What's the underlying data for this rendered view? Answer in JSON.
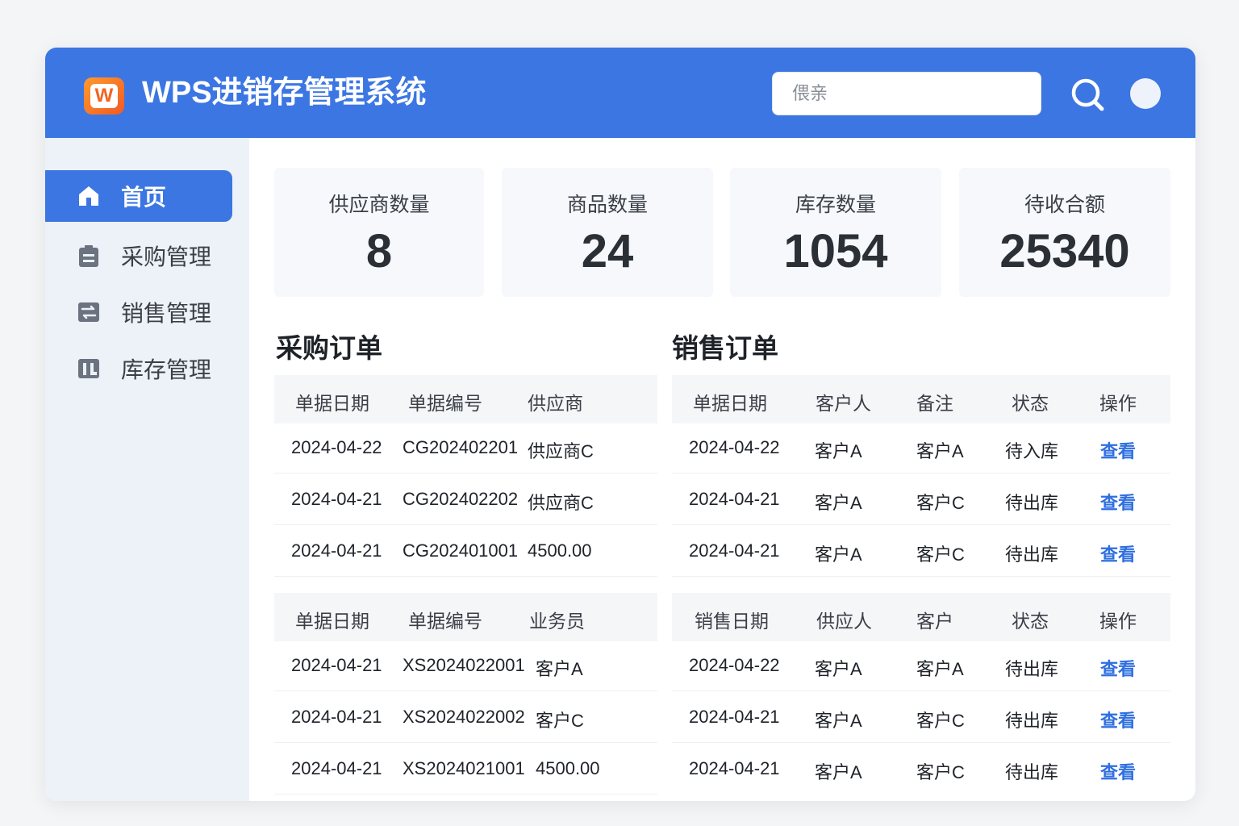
{
  "header": {
    "logo_letter": "W",
    "title": "WPS进销存管理系统",
    "search_placeholder": "偎亲"
  },
  "sidebar": {
    "items": [
      {
        "label": "首页",
        "icon": "home-icon",
        "active": true
      },
      {
        "label": "采购管理",
        "icon": "clipboard-icon",
        "active": false
      },
      {
        "label": "销售管理",
        "icon": "transfer-icon",
        "active": false
      },
      {
        "label": "库存管理",
        "icon": "inventory-icon",
        "active": false
      }
    ]
  },
  "stats": [
    {
      "label": "供应商数量",
      "value": "8"
    },
    {
      "label": "商品数量",
      "value": "24"
    },
    {
      "label": "库存数量",
      "value": "1054"
    },
    {
      "label": "待收合额",
      "value": "25340"
    }
  ],
  "purchase": {
    "title": "采购订单",
    "table1": {
      "headers": [
        "单据日期",
        "单据编号",
        "供应商"
      ],
      "rows": [
        [
          "2024-04-22",
          "CG202402201",
          "供应商C"
        ],
        [
          "2024-04-21",
          "CG202402202",
          "供应商C"
        ],
        [
          "2024-04-21",
          "CG202401001",
          "4500.00"
        ]
      ]
    },
    "table2": {
      "headers": [
        "单据日期",
        "单据编号",
        "业务员"
      ],
      "rows": [
        [
          "2024-04-21",
          "XS2024022001",
          "客户A"
        ],
        [
          "2024-04-21",
          "XS2024022002",
          "客户C"
        ],
        [
          "2024-04-21",
          "XS2024021001",
          "4500.00"
        ]
      ]
    }
  },
  "sales": {
    "title": "销售订单",
    "table1": {
      "headers": [
        "单据日期",
        "客户人",
        "备注",
        "状态",
        "操作"
      ],
      "rows": [
        [
          "2024-04-22",
          "客户A",
          "客户A",
          "待入库",
          "查看"
        ],
        [
          "2024-04-21",
          "客户A",
          "客户C",
          "待出库",
          "查看"
        ],
        [
          "2024-04-21",
          "客户A",
          "客户C",
          "待出库",
          "查看"
        ]
      ]
    },
    "table2": {
      "headers": [
        "销售日期",
        "供应人",
        "客户",
        "状态",
        "操作"
      ],
      "rows": [
        [
          "2024-04-22",
          "客户A",
          "客户A",
          "待出库",
          "查看"
        ],
        [
          "2024-04-21",
          "客户A",
          "客户C",
          "待出库",
          "查看"
        ],
        [
          "2024-04-21",
          "客户A",
          "客户C",
          "待出库",
          "查看"
        ]
      ]
    }
  },
  "colors": {
    "header_bg": "#3b76e3",
    "sidebar_bg": "#edf1f8",
    "link": "#2f6fe0"
  }
}
